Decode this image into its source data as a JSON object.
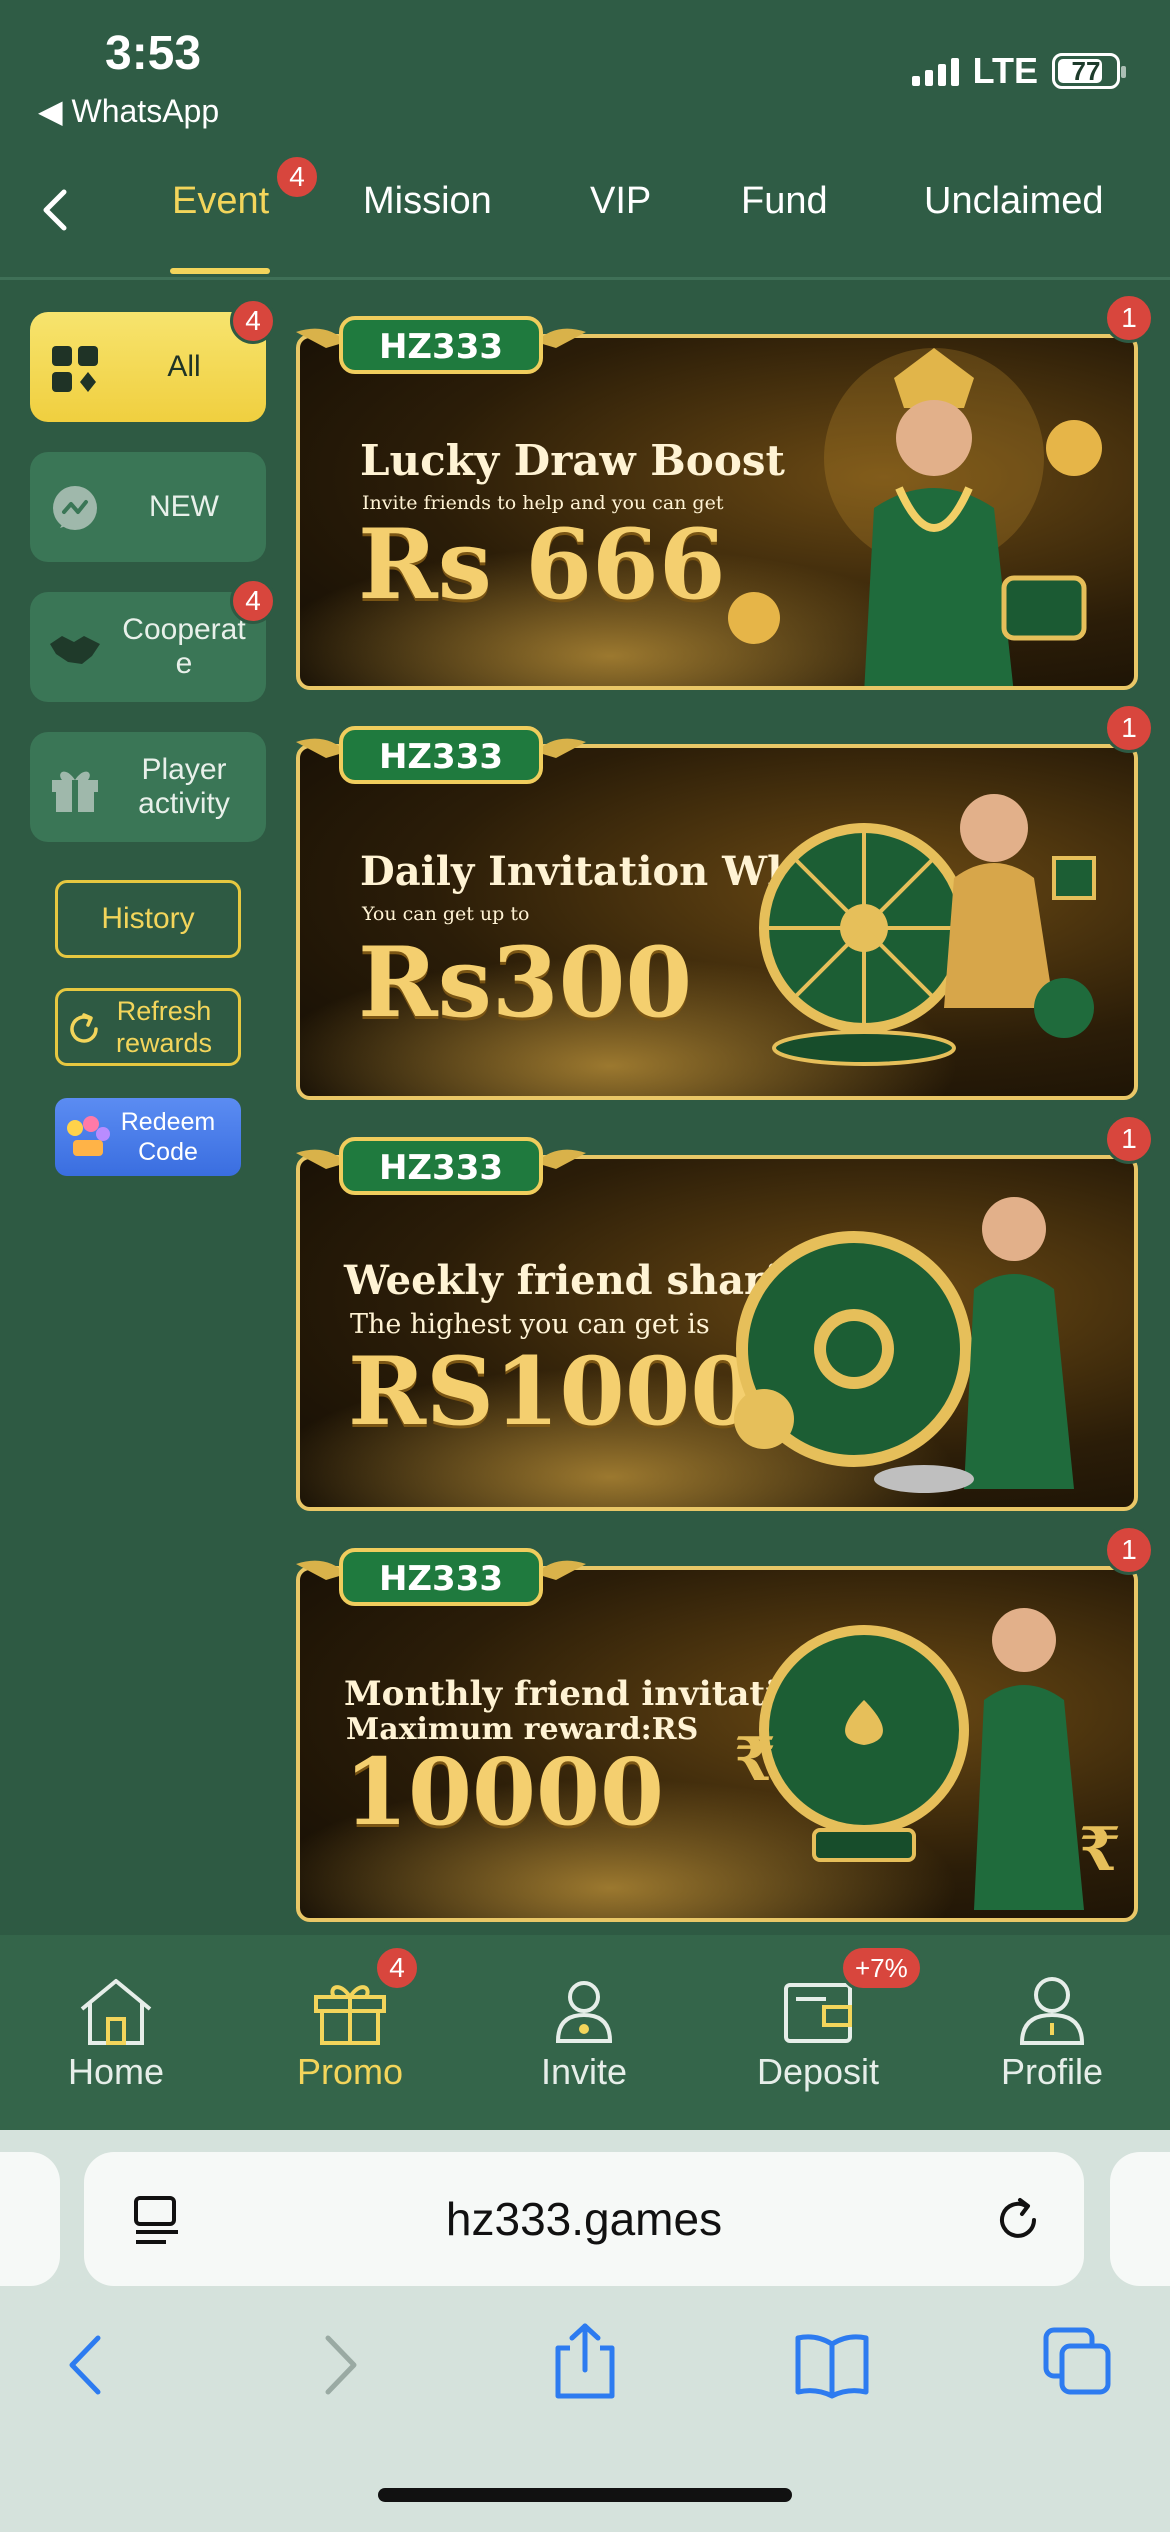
{
  "status_bar": {
    "time": "3:53",
    "back_app": "◀ WhatsApp",
    "network": "LTE",
    "battery": "77"
  },
  "tabs": [
    {
      "label": "Event",
      "badge": "4",
      "active": true
    },
    {
      "label": "Mission"
    },
    {
      "label": "VIP"
    },
    {
      "label": "Fund"
    },
    {
      "label": "Unclaimed"
    }
  ],
  "sidebar": {
    "items": [
      {
        "label": "All",
        "badge": "4",
        "active": true
      },
      {
        "label": "NEW"
      },
      {
        "label": "Cooperat e",
        "badge": "4"
      },
      {
        "label": "Player activity"
      }
    ],
    "history": "History",
    "refresh": "Refresh rewards",
    "redeem": "Redeem Code"
  },
  "banners": [
    {
      "brand": "HZ333",
      "title": "Lucky Draw Boost",
      "subtitle": "Invite friends to help and you can get",
      "amount": "Rs 666",
      "badge": "1"
    },
    {
      "brand": "HZ333",
      "title": "Daily Invitation Wheel",
      "subtitle": "You can get up to",
      "amount": "Rs300",
      "badge": "1"
    },
    {
      "brand": "HZ333",
      "title": "Weekly friend sharing",
      "subtitle": "The highest you can get is",
      "amount": "RS1000",
      "badge": "1"
    },
    {
      "brand": "HZ333",
      "title": "Monthly friend invitations",
      "subtitle": "Maximum reward:RS",
      "amount": "10000",
      "badge": "1"
    }
  ],
  "bottom_nav": [
    {
      "label": "Home",
      "icon": "home-icon"
    },
    {
      "label": "Promo",
      "icon": "gift-icon",
      "badge": "4",
      "active": true
    },
    {
      "label": "Invite",
      "icon": "people-icon"
    },
    {
      "label": "Deposit",
      "icon": "wallet-icon",
      "badge": "+7%"
    },
    {
      "label": "Profile",
      "icon": "person-icon"
    }
  ],
  "browser": {
    "url": "hz333.games"
  },
  "colors": {
    "background": "#2e5a43",
    "accent": "#f3d55b",
    "badge": "#d8463d"
  }
}
